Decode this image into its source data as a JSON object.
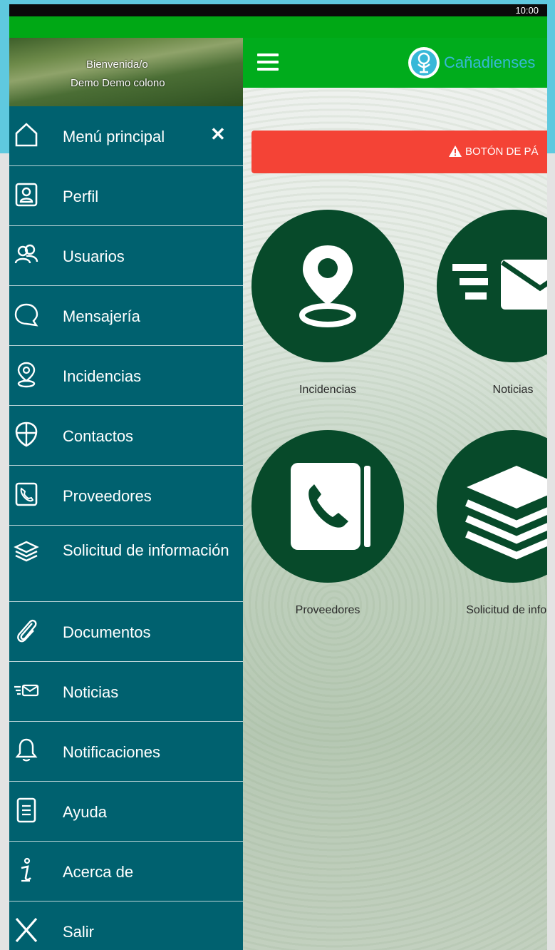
{
  "status_bar": {
    "time": "10:00"
  },
  "drawer": {
    "greeting": "Bienvenida/o",
    "user_name": "Demo Demo colono",
    "close_label": "✕",
    "items": [
      {
        "label": "Menú principal",
        "icon": "home-icon"
      },
      {
        "label": "Perfil",
        "icon": "profile-icon"
      },
      {
        "label": "Usuarios",
        "icon": "users-icon"
      },
      {
        "label": "Mensajería",
        "icon": "chat-icon"
      },
      {
        "label": "Incidencias",
        "icon": "location-pin-icon"
      },
      {
        "label": "Contactos",
        "icon": "shield-icon"
      },
      {
        "label": "Proveedores",
        "icon": "phone-book-icon"
      },
      {
        "label": "Solicitud de información",
        "icon": "layers-icon"
      },
      {
        "label": "Documentos",
        "icon": "paperclip-icon"
      },
      {
        "label": "Noticias",
        "icon": "news-envelope-icon"
      },
      {
        "label": "Notificaciones",
        "icon": "bell-icon"
      },
      {
        "label": "Ayuda",
        "icon": "document-icon"
      },
      {
        "label": "Acerca de",
        "icon": "info-icon"
      },
      {
        "label": "Salir",
        "icon": "close-icon"
      }
    ]
  },
  "app_bar": {
    "brand": "Cañadienses",
    "menu_icon": "hamburger-icon"
  },
  "panic_button": {
    "label": "BOTÓN DE PÁ",
    "icon": "warning-icon"
  },
  "tiles": [
    {
      "label": "Incidencias",
      "icon": "location-pin-icon"
    },
    {
      "label": "Noticias",
      "icon": "news-envelope-icon"
    },
    {
      "label": "Proveedores",
      "icon": "phone-book-icon"
    },
    {
      "label": "Solicitud de inform",
      "icon": "layers-icon"
    }
  ],
  "colors": {
    "drawer": "#00616f",
    "app_bar": "#00ac1c",
    "tile": "#074a2a",
    "panic": "#f44336",
    "brand_text": "#37b8d8"
  }
}
